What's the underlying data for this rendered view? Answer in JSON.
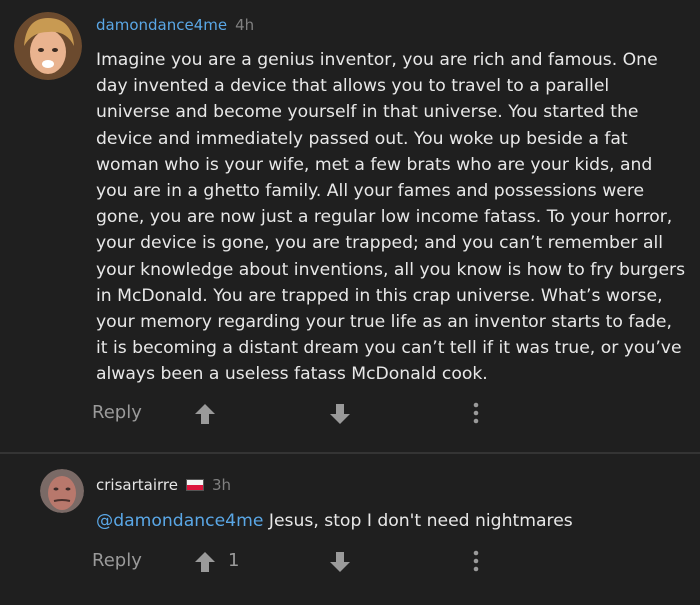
{
  "comments": [
    {
      "username": "damondance4me",
      "time": "4h",
      "text": "Imagine you are a genius inventor, you are rich and famous. One day invented a device that allows you to travel to a parallel universe and become yourself in that universe. You started the device and immediately passed out. You woke up beside a fat woman who is your wife, met a few brats who are your kids, and you are in a ghetto family. All your fames and possessions were gone, you are now just a regular low income fatass. To your horror, your device is gone, you are trapped; and you can’t remember all your knowledge about inventions, all you know is how to fry burgers in McDonald. You are trapped in this crap universe. What’s worse, your memory regarding your true life as an inventor starts to fade, it is becoming a distant dream you can’t tell if it was true, or you’ve always been a useless fatass McDonald cook.",
      "reply_label": "Reply",
      "upvote_icon": "arrow-up-icon",
      "downvote_icon": "arrow-down-icon",
      "more_icon": "more-vertical-icon"
    },
    {
      "username": "crisartairre",
      "flag": "poland-flag",
      "time": "3h",
      "mention": "@damondance4me",
      "text": " Jesus, stop I don't need nightmares",
      "reply_label": "Reply",
      "upvotes": "1",
      "upvote_icon": "arrow-up-icon",
      "downvote_icon": "arrow-down-icon",
      "more_icon": "more-vertical-icon"
    }
  ],
  "colors": {
    "background": "#1f1f1f",
    "username_link": "#5aa7e6",
    "text": "#e8e8e8",
    "muted": "#9a9a9a"
  }
}
